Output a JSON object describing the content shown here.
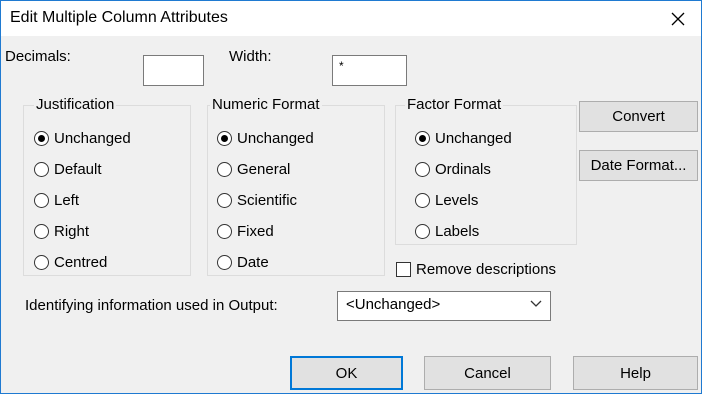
{
  "window": {
    "title": "Edit Multiple Column Attributes"
  },
  "fields": {
    "decimals_label": "Decimals:",
    "decimals_value": "",
    "width_label": "Width:",
    "width_value": "*"
  },
  "justification": {
    "label": "Justification",
    "options": [
      "Unchanged",
      "Default",
      "Left",
      "Right",
      "Centred"
    ],
    "selected": "Unchanged"
  },
  "numeric_format": {
    "label": "Numeric Format",
    "options": [
      "Unchanged",
      "General",
      "Scientific",
      "Fixed",
      "Date"
    ],
    "selected": "Unchanged"
  },
  "factor_format": {
    "label": "Factor Format",
    "options": [
      "Unchanged",
      "Ordinals",
      "Levels",
      "Labels"
    ],
    "selected": "Unchanged"
  },
  "side_buttons": {
    "convert": "Convert",
    "date_format": "Date Format..."
  },
  "remove_descriptions": {
    "label": "Remove descriptions",
    "checked": false
  },
  "identifying": {
    "label": "Identifying information used in Output:",
    "selected": "<Unchanged>"
  },
  "footer": {
    "ok": "OK",
    "cancel": "Cancel",
    "help": "Help"
  }
}
